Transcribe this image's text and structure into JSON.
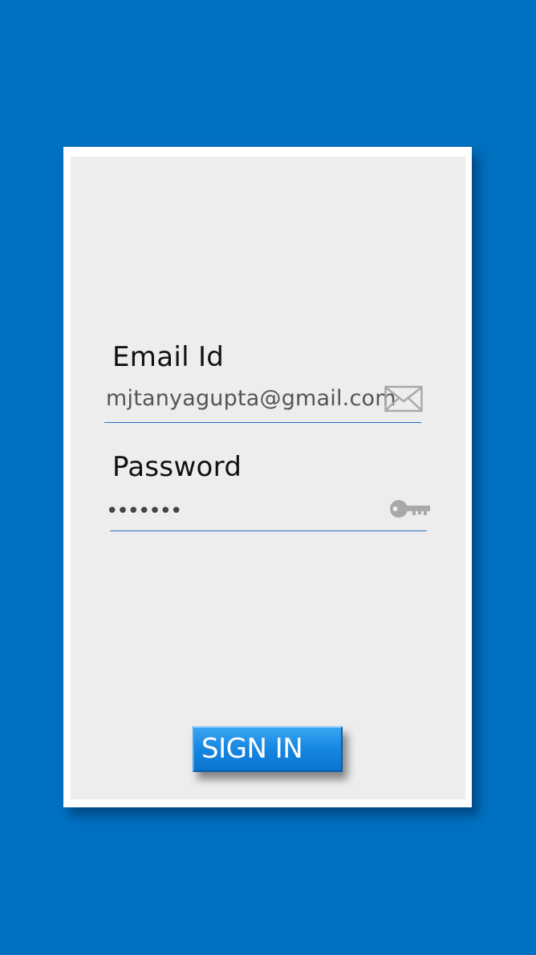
{
  "form": {
    "email_label": "Email Id",
    "email_value": "mjtanyagupta@gmail.com",
    "email_icon": "mail-icon",
    "password_label": "Password",
    "password_value": "•••••••",
    "password_icon": "key-icon",
    "signin_label": "SIGN IN"
  },
  "colors": {
    "background": "#0070c0",
    "card": "#eeeded",
    "underline": "#2e6fc4",
    "button": "#1888e3",
    "icon": "#a9a9a9"
  }
}
